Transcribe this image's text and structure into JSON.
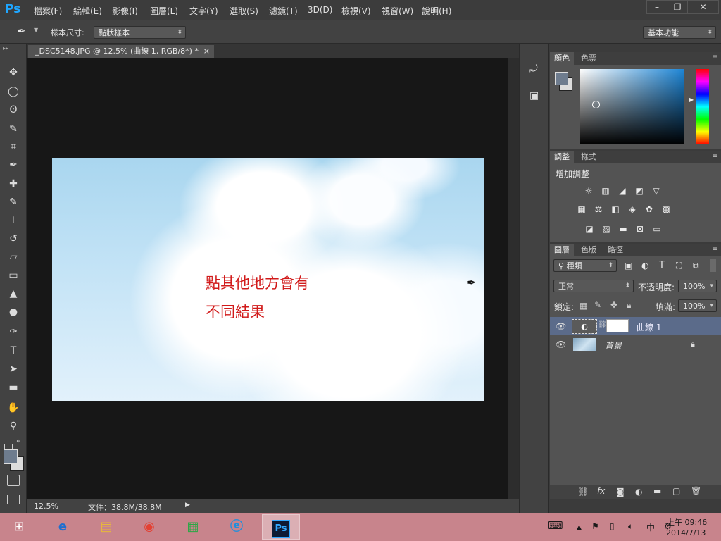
{
  "app": {
    "logo": "Ps",
    "menus": [
      "檔案(F)",
      "編輯(E)",
      "影像(I)",
      "圖層(L)",
      "文字(Y)",
      "選取(S)",
      "濾鏡(T)",
      "3D(D)",
      "檢視(V)",
      "視窗(W)",
      "說明(H)"
    ],
    "window_buttons": [
      "–",
      "❐",
      "✕"
    ]
  },
  "options_bar": {
    "tool_icon": "eyedropper-icon",
    "sample_size_label": "樣本尺寸:",
    "sample_size_value": "點狀樣本",
    "workspace": "基本功能"
  },
  "tools": [
    {
      "name": "move-tool",
      "glyph": "✥"
    },
    {
      "name": "marquee-tool",
      "glyph": "◯"
    },
    {
      "name": "lasso-tool",
      "glyph": "ʘ"
    },
    {
      "name": "quick-select-tool",
      "glyph": "✎"
    },
    {
      "name": "crop-tool",
      "glyph": "⌗"
    },
    {
      "name": "eyedropper-tool",
      "glyph": "✒"
    },
    {
      "name": "healing-tool",
      "glyph": "✚"
    },
    {
      "name": "brush-tool",
      "glyph": "✎"
    },
    {
      "name": "stamp-tool",
      "glyph": "⊥"
    },
    {
      "name": "history-brush-tool",
      "glyph": "↺"
    },
    {
      "name": "eraser-tool",
      "glyph": "▱"
    },
    {
      "name": "gradient-tool",
      "glyph": "▭"
    },
    {
      "name": "blur-tool",
      "glyph": "▲"
    },
    {
      "name": "dodge-tool",
      "glyph": "●"
    },
    {
      "name": "pen-tool",
      "glyph": "✑"
    },
    {
      "name": "type-tool",
      "glyph": "T"
    },
    {
      "name": "path-select-tool",
      "glyph": "➤"
    },
    {
      "name": "shape-tool",
      "glyph": "▬"
    },
    {
      "name": "hand-tool",
      "glyph": "✋"
    },
    {
      "name": "zoom-tool",
      "glyph": "⚲"
    }
  ],
  "document": {
    "tab_title": "_DSC5148.JPG @ 12.5% (曲線 1, RGB/8*) *",
    "tab_close": "×",
    "note_line1": "點其他地方會有",
    "note_line2": "不同結果",
    "zoom": "12.5%",
    "file_info": "文件：38.8M/38.8M"
  },
  "panels": {
    "color": {
      "tabs": [
        "顏色",
        "色票"
      ]
    },
    "adjustments": {
      "tabs": [
        "調整",
        "樣式"
      ],
      "heading": "增加調整",
      "icons": [
        [
          "brightness-icon",
          "levels-icon",
          "curves-icon",
          "exposure-icon",
          "vibrance-icon"
        ],
        [
          "hue-icon",
          "color-balance-icon",
          "bw-icon",
          "photo-filter-icon",
          "channel-mixer-icon",
          "color-lookup-icon"
        ],
        [
          "invert-icon",
          "posterize-icon",
          "threshold-icon",
          "selective-color-icon",
          "gradient-map-icon"
        ]
      ]
    },
    "layers": {
      "tabs": [
        "圖層",
        "色版",
        "路徑"
      ],
      "filter_kind": "種類",
      "blend_mode": "正常",
      "opacity_label": "不透明度:",
      "opacity_value": "100%",
      "lock_label": "鎖定:",
      "fill_label": "填滿:",
      "fill_value": "100%",
      "items": [
        {
          "name": "曲線 1",
          "selected": true
        },
        {
          "name": "背景",
          "selected": false
        }
      ]
    }
  },
  "taskbar": {
    "apps": [
      "windows-start-icon",
      "ie-icon",
      "explorer-icon",
      "chrome-icon",
      "store-icon",
      "ie-alt-icon",
      "photoshop-icon"
    ],
    "ime": "中",
    "time": "上午 09:46",
    "date": "2014/7/13"
  },
  "colors": {
    "bg_dark": "#282828",
    "panel": "#535353",
    "note_red": "#d11a1a",
    "taskbar": "#c8848c",
    "accent": "#1fa6ff"
  }
}
